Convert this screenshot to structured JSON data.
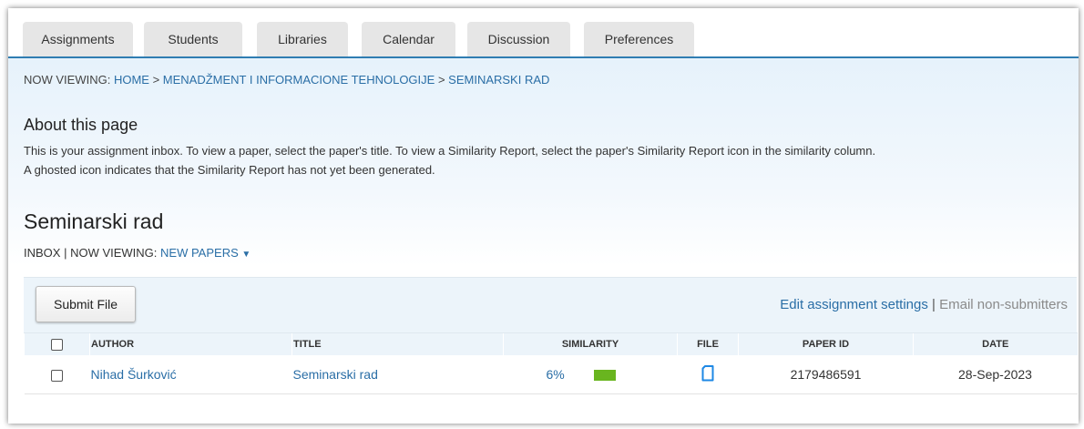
{
  "tabs": [
    {
      "label": "Assignments"
    },
    {
      "label": "Students"
    },
    {
      "label": "Libraries"
    },
    {
      "label": "Calendar"
    },
    {
      "label": "Discussion"
    },
    {
      "label": "Preferences"
    }
  ],
  "breadcrumb": {
    "prefix": "NOW VIEWING: ",
    "home": "HOME",
    "sep1": " > ",
    "course": "MENADŽMENT I INFORMACIONE TEHNOLOGIJE",
    "sep2": " > ",
    "assignment": "SEMINARSKI RAD"
  },
  "about": {
    "title": "About this page",
    "line1": "This is your assignment inbox. To view a paper, select the paper's title. To view a Similarity Report, select the paper's Similarity Report icon in the similarity column.",
    "line2": "A ghosted icon indicates that the Similarity Report has not yet been generated."
  },
  "assignment": {
    "title": "Seminarski rad",
    "inbox_label": "INBOX",
    "divider": " | ",
    "now_viewing": "NOW VIEWING: ",
    "view_filter": "NEW PAPERS",
    "dropdown_glyph": "▼"
  },
  "toolbar": {
    "submit_label": "Submit File",
    "edit_settings": "Edit assignment settings",
    "separator": " | ",
    "email_nonsubmitters": "Email non-submitters"
  },
  "table": {
    "headers": {
      "author": "AUTHOR",
      "title": "TITLE",
      "similarity": "SIMILARITY",
      "file": "FILE",
      "paper_id": "PAPER ID",
      "date": "DATE"
    },
    "rows": [
      {
        "author": "Nihad Šurković",
        "title": "Seminarski rad",
        "similarity": "6%",
        "similarity_color": "#69b51f",
        "file_icon": "document-icon",
        "paper_id": "2179486591",
        "date": "28-Sep-2023"
      }
    ]
  },
  "colors": {
    "accent": "#2f7db2",
    "link": "#2a6ea6",
    "band_bg": "#e6f2fb"
  }
}
